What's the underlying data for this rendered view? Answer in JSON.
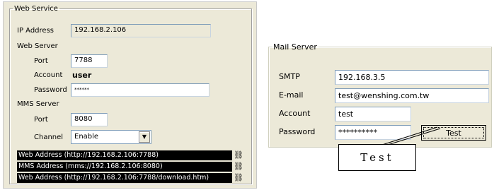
{
  "web_service": {
    "legend": "Web Service",
    "ip_label": "IP Address",
    "ip_value": "192.168.2.106",
    "web_server_label": "Web Server",
    "port_label": "Port",
    "port_value": "7788",
    "account_label": "Account",
    "account_value": "user",
    "password_label": "Password",
    "password_value": "******",
    "mms_server_label": "MMS Server",
    "mms_port_label": "Port",
    "mms_port_value": "8080",
    "channel_label": "Channel",
    "channel_value": "Enable",
    "addresses": [
      {
        "text": "Web Address  (http://192.168.2.106:7788)",
        "icon": "network-link-icon"
      },
      {
        "text": "MMS Address  (mms://192.168.2.106:8080)",
        "icon": "network-link-icon"
      },
      {
        "text": "Web Address  (http://192.168.2.106:7788/download.htm)",
        "icon": "network-link-icon"
      }
    ]
  },
  "mail_server": {
    "legend": "Mail Server",
    "smtp_label": "SMTP",
    "smtp_value": "192.168.3.5",
    "email_label": "E-mail",
    "email_value": "test@wenshing.com.tw",
    "account_label": "Account",
    "account_value": "test",
    "password_label": "Password",
    "password_value": "**********",
    "test_button": "Test"
  },
  "callout": {
    "text": "Test"
  },
  "colors": {
    "dialog_bg": "#ece9d8",
    "address_bar_bg": "#000000",
    "input_border": "#7f9db9"
  }
}
